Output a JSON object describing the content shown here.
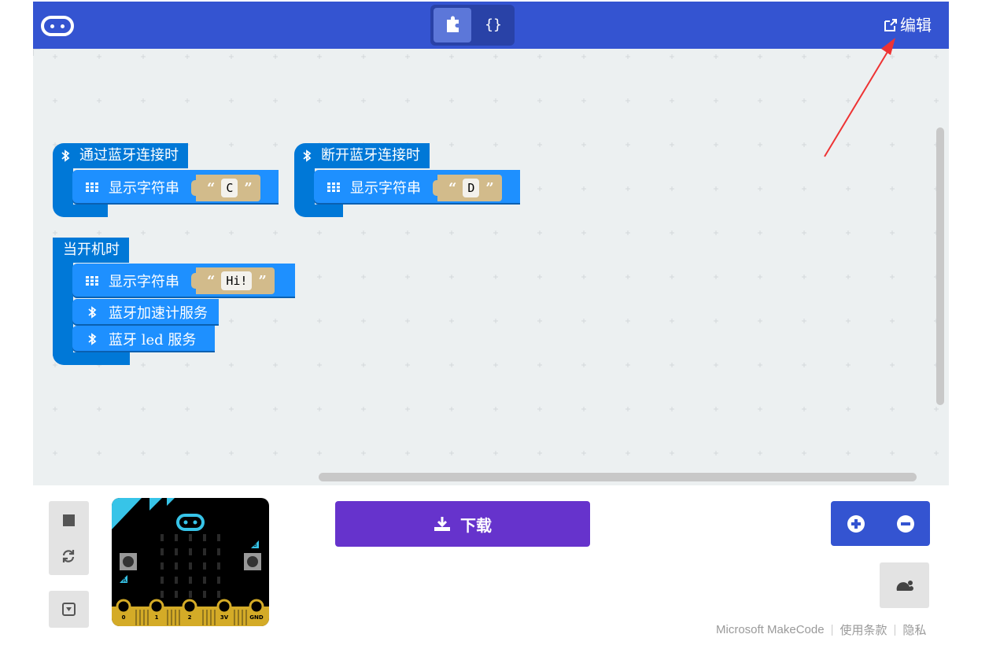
{
  "header": {
    "blocks_toggle_icon": "puzzle-icon",
    "js_toggle_label": "{}",
    "edit_label": "编辑",
    "edit_icon": "external-link-icon"
  },
  "workspace": {
    "event_connected": {
      "label": "通过蓝牙连接时",
      "stmt_label": "显示字符串",
      "value": "C"
    },
    "event_disconnected": {
      "label": "断开蓝牙连接时",
      "stmt_label": "显示字符串",
      "value": "D"
    },
    "on_start": {
      "label": "当开机时",
      "stmt1_label": "显示字符串",
      "stmt1_value": "Hi!",
      "stmt2_label": "蓝牙加速计服务",
      "stmt3_label": "蓝牙 led 服务"
    },
    "quote_open": "“",
    "quote_close": "”"
  },
  "bottom": {
    "download_label": "下载",
    "simulator_pins": [
      "0",
      "1",
      "2",
      "3V",
      "GND"
    ],
    "simulator_buttons": [
      "A",
      "B"
    ]
  },
  "footer": {
    "brand": "Microsoft MakeCode",
    "terms": "使用条款",
    "privacy": "隐私"
  },
  "colors": {
    "header": "#3454d1",
    "event_block": "#0078d7",
    "basic_block": "#1e90ff",
    "string_block": "#d2bb8b",
    "download": "#6633cc",
    "annotation_arrow": "#ee3333"
  }
}
